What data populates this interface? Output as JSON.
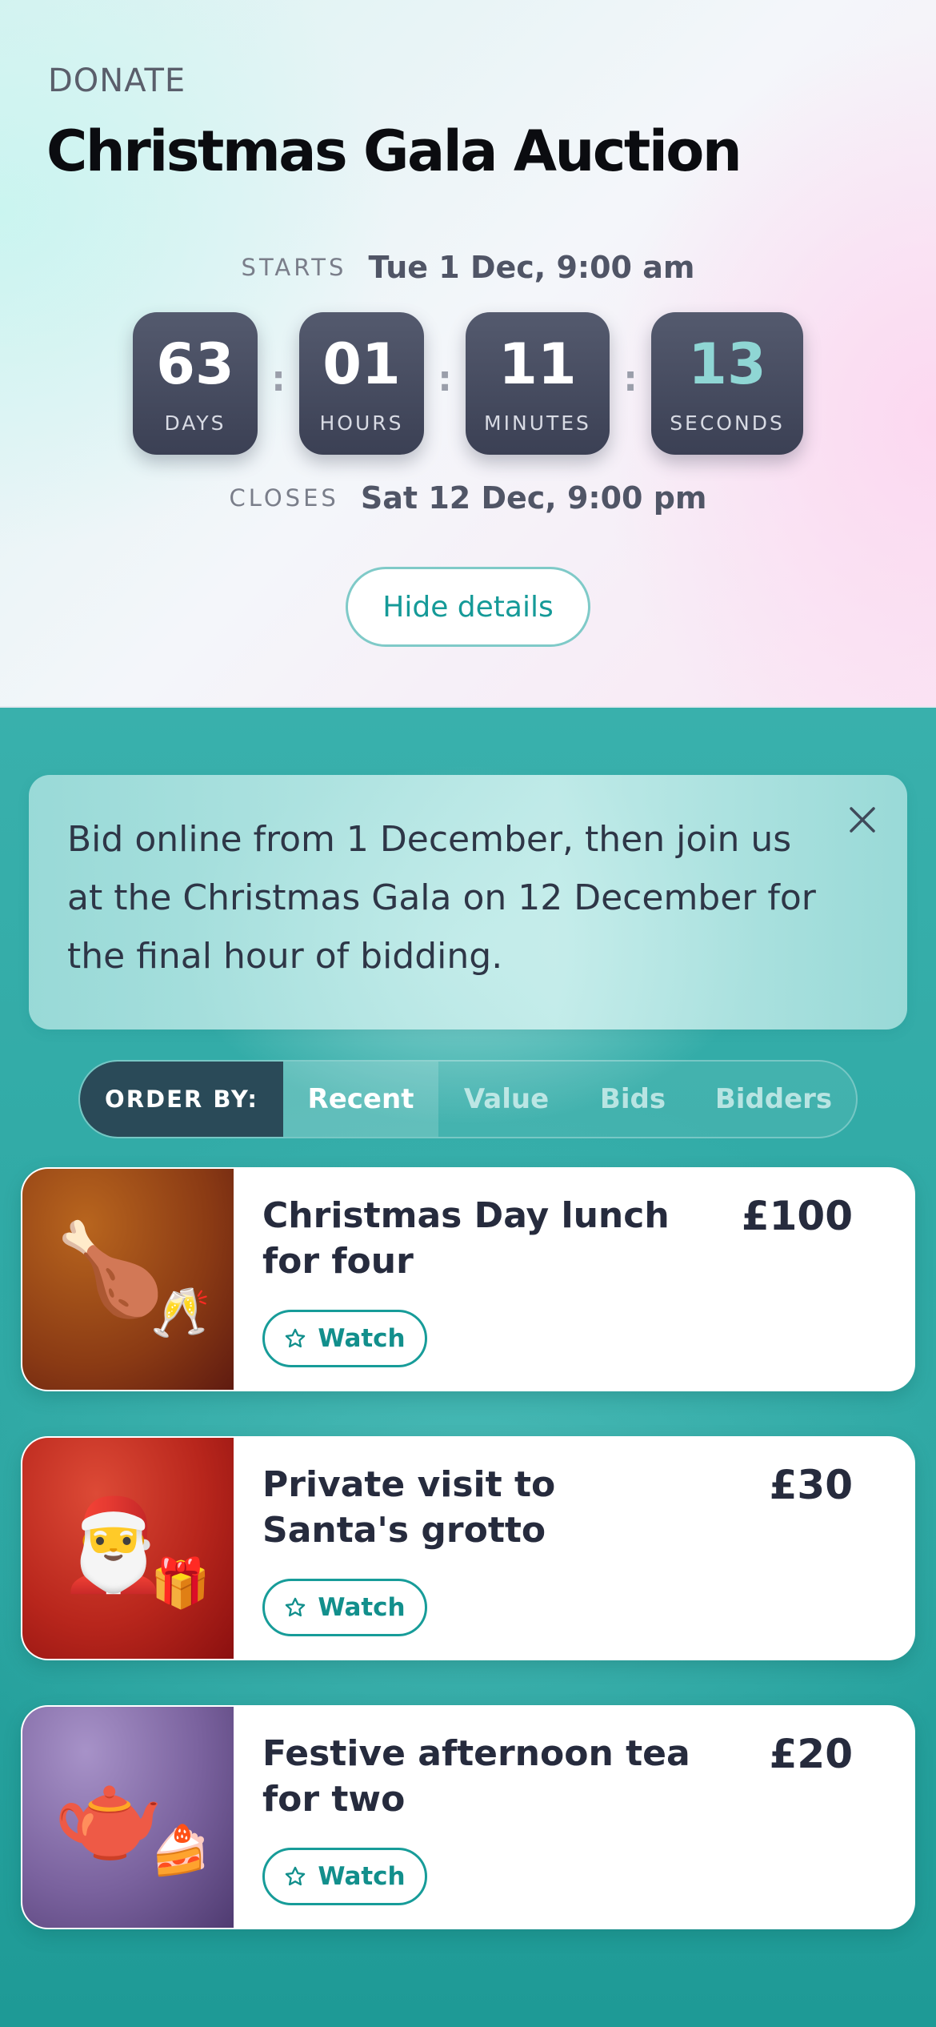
{
  "header": {
    "eyebrow": "DONATE",
    "title": "Christmas Gala Auction",
    "starts_label": "STARTS",
    "starts_value": "Tue 1 Dec, 9:00 am",
    "closes_label": "CLOSES",
    "closes_value": "Sat 12 Dec, 9:00 pm",
    "countdown": [
      {
        "value": "63",
        "unit": "DAYS"
      },
      {
        "value": "01",
        "unit": "HOURS"
      },
      {
        "value": "11",
        "unit": "MINUTES"
      },
      {
        "value": "13",
        "unit": "SECONDS"
      }
    ],
    "separator": ":",
    "toggle_label": "Hide details"
  },
  "notice": {
    "text": "Bid online from 1 December, then join us at the Christmas Gala on 12 December for the final hour of bidding.",
    "close_icon": "close-icon"
  },
  "order": {
    "label": "ORDER BY:",
    "options": [
      "Recent",
      "Value",
      "Bids",
      "Bidders"
    ],
    "selected": "Recent"
  },
  "items": [
    {
      "title": "Christmas Day lunch for four",
      "price": "£100",
      "watch_label": "Watch",
      "image": "poultry-leg-and-champagne",
      "emoji_main": "🍗",
      "emoji_side": "🥂"
    },
    {
      "title": "Private visit to Santa's grotto",
      "price": "£30",
      "watch_label": "Watch",
      "image": "santa-and-gift",
      "emoji_main": "🎅",
      "emoji_side": "🎁"
    },
    {
      "title": "Festive afternoon tea for two",
      "price": "£20",
      "watch_label": "Watch",
      "image": "teapot-and-cake",
      "emoji_main": "🫖",
      "emoji_side": "🍰"
    }
  ],
  "colors": {
    "accent": "#179c99",
    "timer_box": "#454a5e",
    "seconds_accent": "#8fd6d4",
    "background_teal": "#2fa9a5"
  }
}
